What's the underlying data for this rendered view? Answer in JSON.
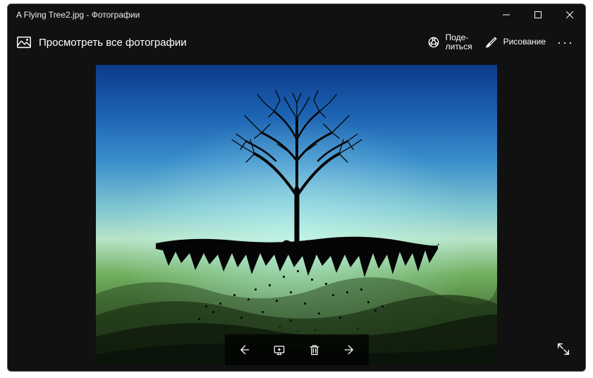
{
  "window": {
    "title": "A Flying Tree2.jpg - Фотографии"
  },
  "toolbar": {
    "view_all_label": "Просмотреть все фотографии",
    "share_label": "Поде-\nлиться",
    "draw_label": "Рисование"
  },
  "image": {
    "description": "A flying tree island silhouette against a blue-green gradient sky"
  }
}
